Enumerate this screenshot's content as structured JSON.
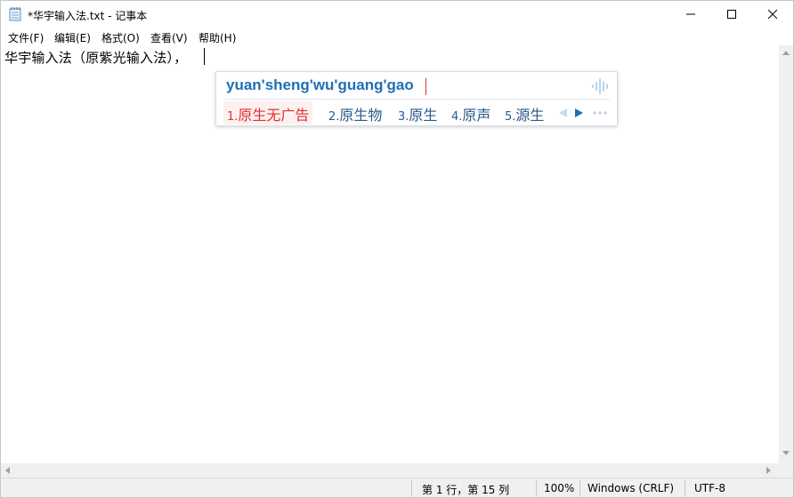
{
  "window": {
    "title": "*华宇输入法.txt - 记事本",
    "icon": "notepad-icon"
  },
  "window_controls": {
    "minimize": "minimize-icon",
    "maximize": "maximize-icon",
    "close": "close-icon"
  },
  "menu": {
    "items": [
      {
        "label": "文件(F)"
      },
      {
        "label": "编辑(E)"
      },
      {
        "label": "格式(O)"
      },
      {
        "label": "查看(V)"
      },
      {
        "label": "帮助(H)"
      }
    ]
  },
  "editor": {
    "content": "华宇输入法（原紫光输入法），"
  },
  "ime": {
    "composition": "yuan'sheng'wu'guang'gao",
    "candidates": [
      {
        "num": "1.",
        "text": "原生无广告",
        "selected": true
      },
      {
        "num": "2.",
        "text": "原生物",
        "selected": false
      },
      {
        "num": "3.",
        "text": "原生",
        "selected": false
      },
      {
        "num": "4.",
        "text": "原声",
        "selected": false
      },
      {
        "num": "5.",
        "text": "源生",
        "selected": false
      }
    ],
    "colors": {
      "composition": "#1e6fb5",
      "selected": "#e03030",
      "candidate": "#2a5a8a"
    }
  },
  "status": {
    "position": "第 1 行，第 15 列",
    "zoom": "100%",
    "line_ending": "Windows (CRLF)",
    "encoding": "UTF-8"
  }
}
